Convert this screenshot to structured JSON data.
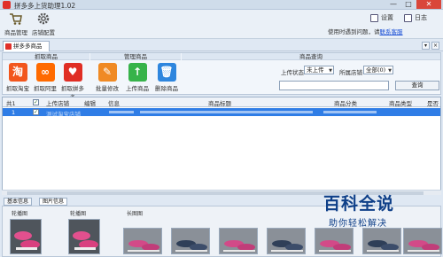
{
  "window": {
    "title": "拼多多上货助理1.02",
    "min_glyph": "—",
    "max_glyph": "□",
    "close_glyph": "✕"
  },
  "toolbar": {
    "buttons": [
      {
        "label": "商品管理",
        "icon": "shopping-cart-icon"
      },
      {
        "label": "店铺配置",
        "icon": "gear-icon"
      }
    ],
    "settings_label": "设置",
    "log_label": "日志",
    "help_text": "使用时遇到问题，请",
    "help_link": "联系客服"
  },
  "tabs": [
    {
      "label": "拼多多商品",
      "active": true
    }
  ],
  "panel": {
    "group_fetch": "抓取商品",
    "group_manage": "管理商品",
    "group_query": "商品查询",
    "fetch_buttons": [
      {
        "label": "抓取淘宝",
        "icon": "taobao-icon",
        "glyph": "淘",
        "color": "#f2561d"
      },
      {
        "label": "抓取阿里",
        "icon": "alibaba-icon",
        "glyph": "∞",
        "color": "#ff6a00"
      },
      {
        "label": "抓取拼多多",
        "icon": "pinduoduo-icon",
        "glyph": "♥",
        "color": "#e02e24"
      }
    ],
    "manage_buttons": [
      {
        "label": "批量修改",
        "icon": "pencil-icon",
        "glyph": "✎",
        "color": "#f08a24"
      },
      {
        "label": "上传商品",
        "icon": "upload-icon",
        "glyph": "↑",
        "color": "#37b34a"
      },
      {
        "label": "删除商品",
        "icon": "trash-icon",
        "glyph": "🗑",
        "color": "#2e86de"
      }
    ],
    "query": {
      "upload_status_label": "上传状态",
      "upload_status_value": "未上传",
      "shop_label": "所属店铺",
      "shop_value": "全部(0)",
      "search_placeholder": "",
      "search_button": "查询"
    }
  },
  "grid": {
    "total": "共1",
    "columns": [
      "上传店铺",
      "编辑",
      "信息",
      "商品标题",
      "商品分类",
      "商品类型",
      "是否"
    ],
    "rows": [
      {
        "index": "1",
        "checked": true,
        "shop": "测试淘宝店铺"
      }
    ]
  },
  "bottom_tabs": [
    "基本信息",
    "图片信息"
  ],
  "images": {
    "main_label": "轮播图",
    "detail_label": "轮播图",
    "sku_label": "长图图"
  },
  "watermark": {
    "title": "百科全说",
    "subtitle": "助你轻松解决"
  }
}
